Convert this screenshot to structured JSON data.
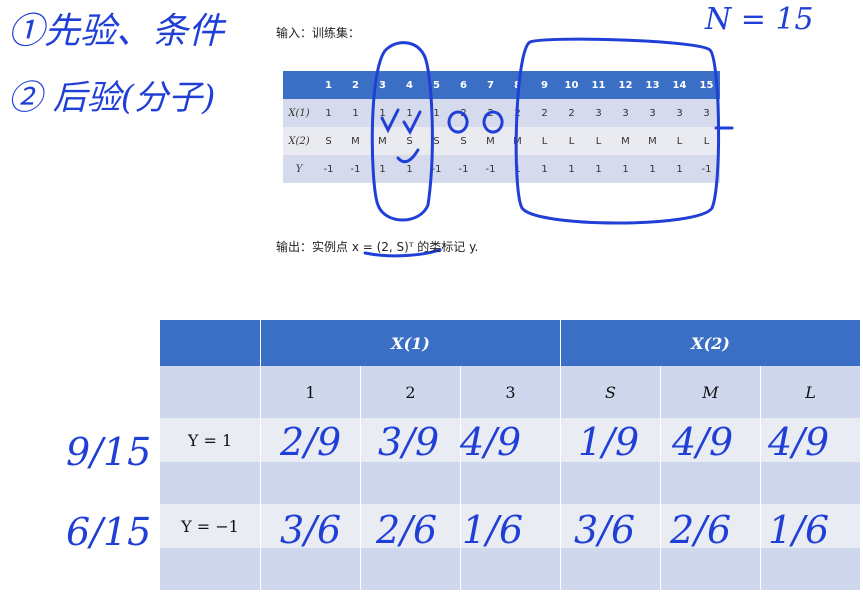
{
  "notes": {
    "line1": "①先验、条件",
    "line2": "② 后验(分子)",
    "n_eq": "N = 15"
  },
  "input_label": "输入：训练集：",
  "output_label": "输出：实例点 x = (2, S)ᵀ 的类标记 y.",
  "train": {
    "header": [
      "",
      "1",
      "2",
      "3",
      "4",
      "5",
      "6",
      "7",
      "8",
      "9",
      "10",
      "11",
      "12",
      "13",
      "14",
      "15"
    ],
    "rows": [
      {
        "label": "X(1)",
        "values": [
          "1",
          "1",
          "1",
          "1",
          "1",
          "2",
          "2",
          "2",
          "2",
          "2",
          "3",
          "3",
          "3",
          "3",
          "3"
        ]
      },
      {
        "label": "X(2)",
        "values": [
          "S",
          "M",
          "M",
          "S",
          "S",
          "S",
          "M",
          "M",
          "L",
          "L",
          "L",
          "M",
          "M",
          "L",
          "L"
        ]
      },
      {
        "label": "Y",
        "values": [
          "-1",
          "-1",
          "1",
          "1",
          "-1",
          "-1",
          "-1",
          "1",
          "1",
          "1",
          "1",
          "1",
          "1",
          "1",
          "-1"
        ]
      }
    ]
  },
  "prob": {
    "group1": "X(1)",
    "group2": "X(2)",
    "cols": [
      "1",
      "2",
      "3",
      "S",
      "M",
      "L"
    ],
    "row1_label": "Y = 1",
    "row2_label": "Y = −1",
    "prior1": "9/15",
    "prior2": "6/15",
    "row1_vals": [
      "2/9",
      "3/9",
      "4/9",
      "1/9",
      "4/9",
      "4/9"
    ],
    "row2_vals": [
      "3/6",
      "2/6",
      "1/6",
      "3/6",
      "2/6",
      "1/6"
    ]
  }
}
